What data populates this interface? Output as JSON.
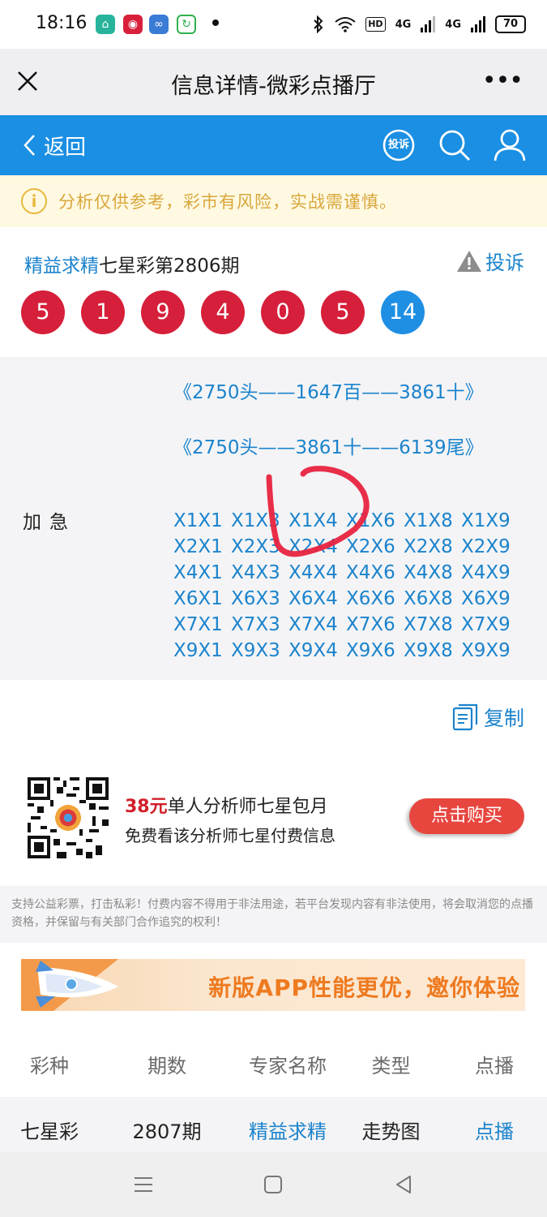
{
  "status_bar": {
    "time": "18:16",
    "network_1": "4G",
    "network_2": "4G",
    "hd_label": "HD",
    "battery": "70",
    "icons": [
      "home-app-icon",
      "red-app-icon",
      "infinity-app-icon",
      "green-app-icon",
      "bluetooth-icon",
      "wifi-icon",
      "signal-icon"
    ]
  },
  "title_bar": {
    "title": "信息详情-微彩点播厅",
    "more_label": "•••"
  },
  "nav_bar": {
    "back_label": "返回",
    "complain_badge": "投诉"
  },
  "notice": {
    "icon_glyph": "i",
    "text": "分析仅供参考，彩市有风险，实战需谨慎。"
  },
  "info": {
    "expert_name": "精益求精",
    "issue_title": "七星彩第2806期",
    "complain_label": "投诉",
    "balls": [
      "5",
      "1",
      "9",
      "4",
      "0",
      "5",
      "14"
    ]
  },
  "content": {
    "route_lines": [
      "《2750头——1647百——3861十》",
      "《2750头——3861十——6139尾》"
    ],
    "label": "加急",
    "combos": [
      "X1X1",
      "X1X3",
      "X1X4",
      "X1X6",
      "X1X8",
      "X1X9",
      "X2X1",
      "X2X3",
      "X2X4",
      "X2X6",
      "X2X8",
      "X2X9",
      "X4X1",
      "X4X3",
      "X4X4",
      "X4X6",
      "X4X8",
      "X4X9",
      "X6X1",
      "X6X3",
      "X6X4",
      "X6X6",
      "X6X8",
      "X6X9",
      "X7X1",
      "X7X3",
      "X7X4",
      "X7X6",
      "X7X8",
      "X7X9",
      "X9X1",
      "X9X3",
      "X9X4",
      "X9X6",
      "X9X8",
      "X9X9"
    ]
  },
  "copy": {
    "label": "复制"
  },
  "promo": {
    "price": "38元",
    "title": "单人分析师七星包月",
    "subtitle": "免费看该分析师七星付费信息",
    "buy_label": "点击购买"
  },
  "disclaimer": "支持公益彩票，打击私彩！付费内容不得用于非法用途，若平台发现内容有非法使用，将会取消您的点播资格，并保留与有关部门合作追究的权利！",
  "banner": {
    "text": "新版APP性能更优，邀你体验"
  },
  "table": {
    "headers": [
      "彩种",
      "期数",
      "专家名称",
      "类型",
      "点播"
    ],
    "rows": [
      {
        "lottery": "七星彩",
        "issue": "2807期",
        "expert": "精益求精",
        "type": "走势图",
        "action": "点播"
      }
    ]
  },
  "colors": {
    "nav_blue": "#1a8fe3",
    "link_blue": "#1b83cc",
    "ball_red": "#d61f3a",
    "ball_blue": "#1f8fe4",
    "notice_yellow": "#d9a63b",
    "buy_red": "#e7463f"
  }
}
